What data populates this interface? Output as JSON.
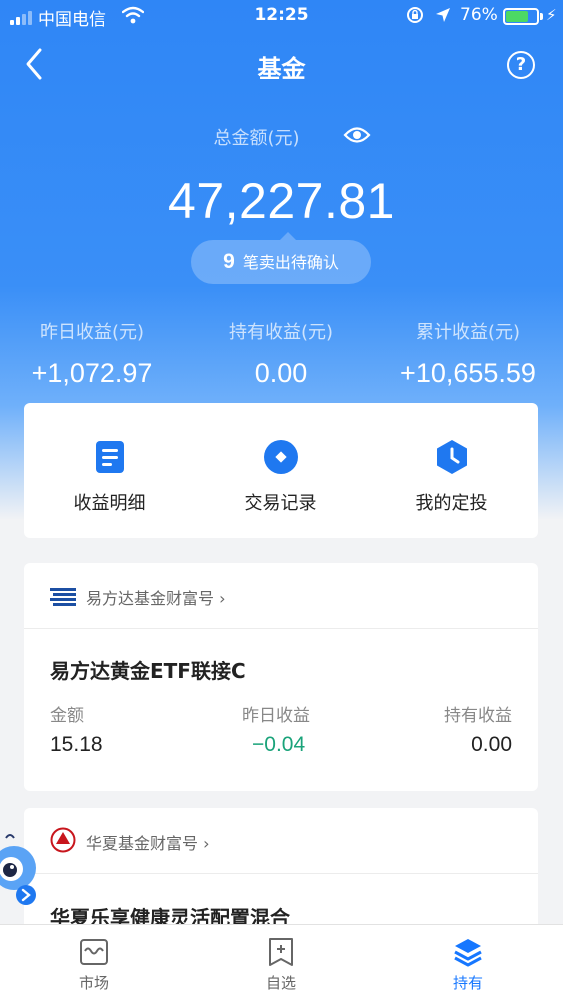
{
  "status_bar": {
    "carrier": "中国电信",
    "time": "12:25",
    "battery": "76%"
  },
  "nav": {
    "title": "基金",
    "help": "?"
  },
  "summary": {
    "total_label": "总金额(元)",
    "total_amount": "47,227.81",
    "pending_count": "9",
    "pending_text": "笔卖出待确认"
  },
  "stats": [
    {
      "label": "昨日收益(元)",
      "value": "+1,072.97"
    },
    {
      "label": "持有收益(元)",
      "value": "0.00"
    },
    {
      "label": "累计收益(元)",
      "value": "+10,655.59"
    }
  ],
  "actions": [
    {
      "label": "收益明细",
      "icon": "document-icon"
    },
    {
      "label": "交易记录",
      "icon": "record-icon"
    },
    {
      "label": "我的定投",
      "icon": "clock-icon"
    }
  ],
  "funds": [
    {
      "company": "易方达基金财富号",
      "name": "易方达黄金ETF联接C",
      "columns": [
        "金额",
        "昨日收益",
        "持有收益"
      ],
      "values": [
        "15.18",
        "−0.04",
        "0.00"
      ]
    },
    {
      "company": "华夏基金财富号",
      "name": "华夏乐享健康灵活配置混合"
    }
  ],
  "tabs": [
    {
      "label": "市场",
      "icon": "market-icon",
      "active": false
    },
    {
      "label": "自选",
      "icon": "watchlist-icon",
      "active": false
    },
    {
      "label": "持有",
      "icon": "holdings-icon",
      "active": true
    }
  ],
  "colors": {
    "primary": "#2f86f6",
    "negative": "#1aa37a",
    "active_tab": "#1677ff"
  }
}
